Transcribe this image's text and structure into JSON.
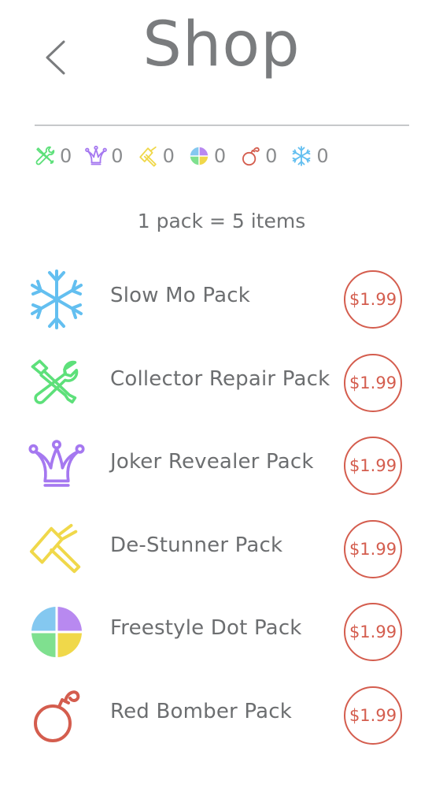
{
  "header": {
    "title": "Shop",
    "back_icon": "chevron-left-icon"
  },
  "inventory": [
    {
      "icon": "wrench-screwdriver-icon",
      "color": "#5de07a",
      "count": "0"
    },
    {
      "icon": "jester-hat-icon",
      "color": "#a578f0",
      "count": "0"
    },
    {
      "icon": "hammer-icon",
      "color": "#f0d84a",
      "count": "0"
    },
    {
      "icon": "color-dot-icon",
      "color": "#84c8f0",
      "count": "0"
    },
    {
      "icon": "bomb-icon",
      "color": "#d45d4e",
      "count": "0"
    },
    {
      "icon": "snowflake-icon",
      "color": "#63bff0",
      "count": "0"
    }
  ],
  "pack_note": "1 pack = 5 items",
  "packs": [
    {
      "name": "Slow Mo Pack",
      "price": "$1.99",
      "icon": "snowflake-icon",
      "color": "#63bff0"
    },
    {
      "name": "Collector Repair Pack",
      "price": "$1.99",
      "icon": "wrench-screwdriver-icon",
      "color": "#5de07a"
    },
    {
      "name": "Joker Revealer Pack",
      "price": "$1.99",
      "icon": "jester-hat-icon",
      "color": "#a578f0"
    },
    {
      "name": "De-Stunner Pack",
      "price": "$1.99",
      "icon": "hammer-icon",
      "color": "#f0d84a"
    },
    {
      "name": "Freestyle Dot Pack",
      "price": "$1.99",
      "icon": "color-dot-icon",
      "color": "#84c8f0"
    },
    {
      "name": "Red Bomber Pack",
      "price": "$1.99",
      "icon": "bomb-icon",
      "color": "#d45d4e"
    }
  ],
  "colors": {
    "title": "#7a7c7e",
    "text": "#6c6e70",
    "price": "#d45d4e",
    "divider": "#c7c8ca",
    "dot_blue": "#84c8f0",
    "dot_purple": "#b889f0",
    "dot_green": "#7fe08f",
    "dot_yellow": "#f0d84a"
  }
}
